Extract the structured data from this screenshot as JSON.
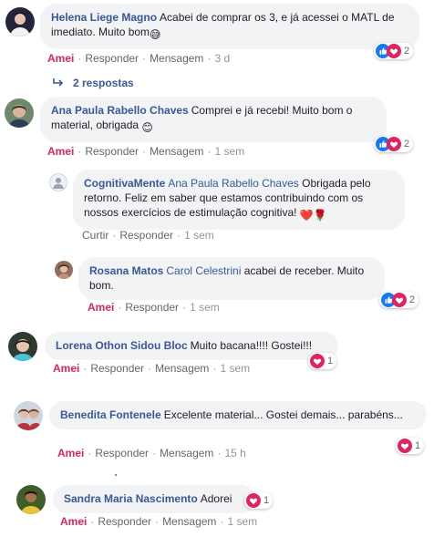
{
  "comments": [
    {
      "author": "Helena Liege Magno",
      "text": "Acabei de comprar os 3, e já acessei o MATL de imediato. Muito bom",
      "emoji": "😅",
      "actions": {
        "like": "Amei",
        "reply": "Responder",
        "message": "Mensagem",
        "time": "3 d"
      },
      "reactions": {
        "types": [
          "like",
          "love"
        ],
        "count": "2"
      },
      "replies_label": "2 respostas"
    },
    {
      "author": "Ana Paula Rabello Chaves",
      "text": "Comprei e já recebi! Muito bom o material, obrigada",
      "emoji": "😊",
      "actions": {
        "like": "Amei",
        "reply": "Responder",
        "message": "Mensagem",
        "time": "1 sem"
      },
      "reactions": {
        "types": [
          "like",
          "love"
        ],
        "count": "2"
      }
    },
    {
      "author": "CognitivaMente",
      "mention": "Ana Paula Rabello Chaves",
      "text": "Obrigada pelo retorno. Feliz em saber que estamos contribuindo com os nossos exercícios de estimulação cognitiva!",
      "emoji": "❤️🌹",
      "actions": {
        "like": "Curtir",
        "reply": "Responder",
        "time": "1 sem"
      }
    },
    {
      "author": "Rosana Matos",
      "mention": "Carol Celestrini",
      "text": "acabei de receber. Muito bom.",
      "actions": {
        "like": "Amei",
        "reply": "Responder",
        "time": "1 sem"
      },
      "reactions": {
        "types": [
          "like",
          "love"
        ],
        "count": "2"
      }
    },
    {
      "author": "Lorena Othon Sidou Bloc",
      "text": "Muito bacana!!!! Gostei!!!",
      "actions": {
        "like": "Amei",
        "reply": "Responder",
        "message": "Mensagem",
        "time": "1 sem"
      },
      "reactions": {
        "types": [
          "love"
        ],
        "count": "1"
      }
    },
    {
      "author": "Benedita Fontenele",
      "text": "Excelente material... Gostei demais... parabéns...",
      "actions": {
        "like": "Amei",
        "reply": "Responder",
        "message": "Mensagem",
        "time": "15 h"
      },
      "reactions": {
        "types": [
          "love"
        ],
        "count": "1"
      }
    },
    {
      "author": "Sandra Maria Nascimento",
      "text": "Adorei",
      "actions": {
        "like": "Amei",
        "reply": "Responder",
        "message": "Mensagem",
        "time": "1 sem"
      },
      "reactions": {
        "types": [
          "love"
        ],
        "count": "1"
      }
    }
  ],
  "colors": {
    "link": "#385898",
    "love": "#e0245e",
    "like": "#1877f2",
    "bubble": "#f2f3f5",
    "meta": "#90949c"
  }
}
